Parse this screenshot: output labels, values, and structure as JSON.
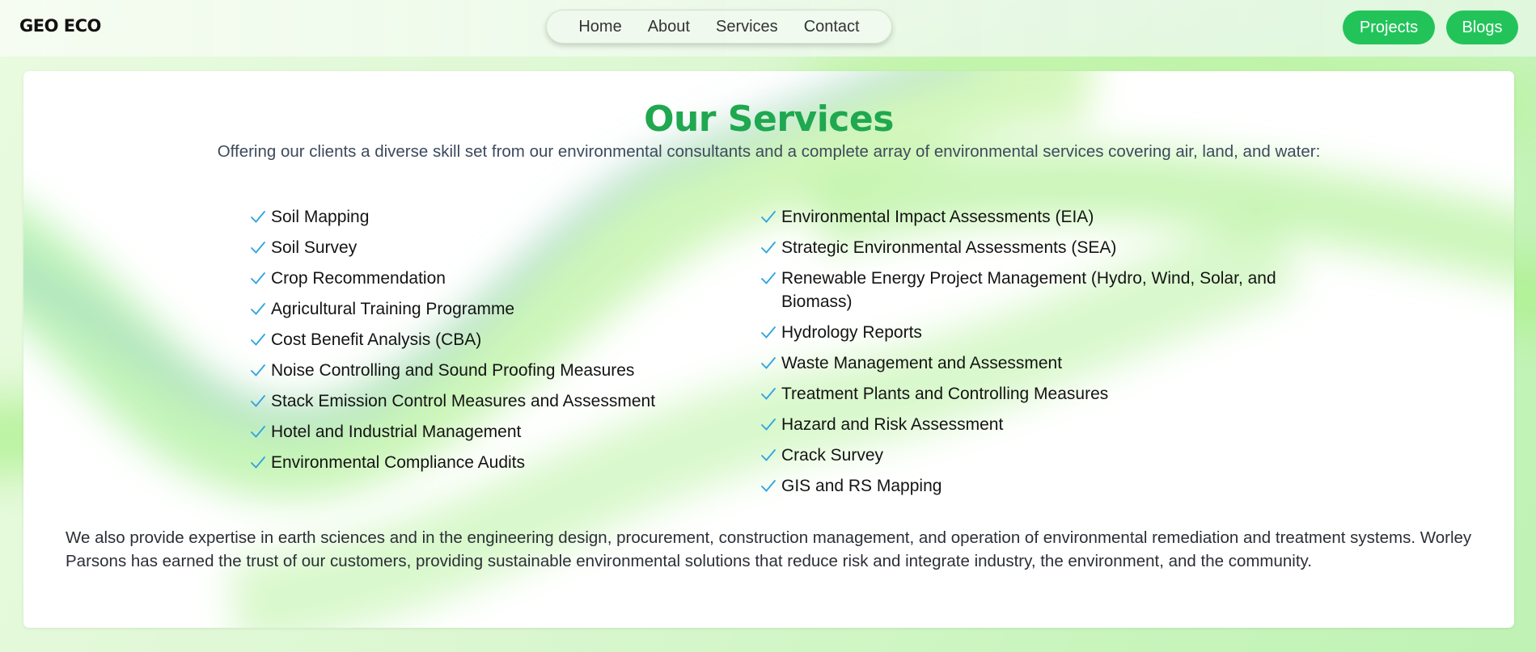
{
  "header": {
    "logo": "GEO ECO",
    "nav": [
      "Home",
      "About",
      "Services",
      "Contact"
    ],
    "buttons": {
      "projects": "Projects",
      "blogs": "Blogs"
    }
  },
  "services": {
    "title": "Our Services",
    "subtitle": "Offering our clients a diverse skill set from our environmental consultants and a complete array of environmental services covering air, land, and water:",
    "left_items": [
      "Soil Mapping",
      "Soil Survey",
      "Crop Recommendation",
      "Agricultural Training Programme",
      "Cost Benefit Analysis (CBA)",
      "Noise Controlling and Sound Proofing Measures",
      "Stack Emission Control Measures and Assessment",
      "Hotel and Industrial Management",
      "Environmental Compliance Audits"
    ],
    "right_items": [
      "Environmental Impact Assessments (EIA)",
      "Strategic Environmental Assessments (SEA)",
      "Renewable Energy Project Management (Hydro, Wind, Solar, and Biomass)",
      "Hydrology Reports",
      "Waste Management and Assessment",
      "Treatment Plants and Controlling Measures",
      "Hazard and Risk Assessment",
      "Crack Survey",
      "GIS and RS Mapping"
    ],
    "footer": "We also provide expertise in earth sciences and in the engineering design, procurement, construction management, and operation of environmental remediation and treatment systems. Worley Parsons has earned the trust of our customers, providing sustainable environmental solutions that reduce risk and integrate industry, the environment, and the community."
  },
  "colors": {
    "accent_green": "#22c45a",
    "title_green": "#1fa84f",
    "check_blue": "#2ea3e0"
  },
  "icons": {
    "list_marker": "check-icon"
  }
}
